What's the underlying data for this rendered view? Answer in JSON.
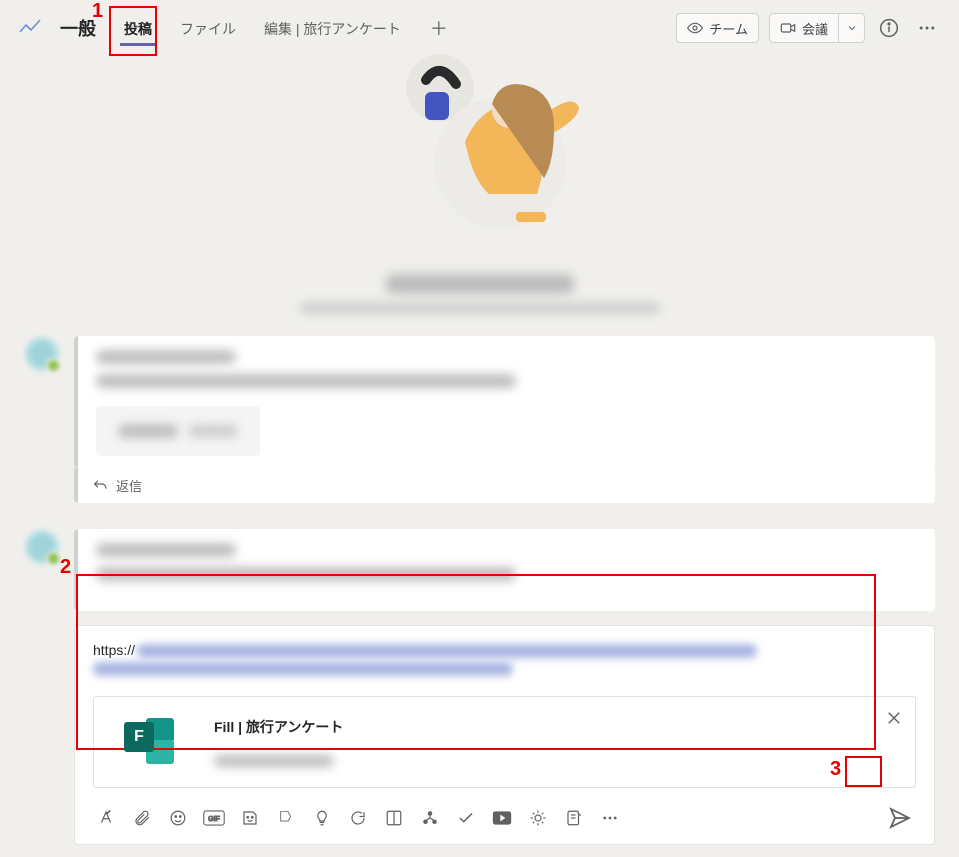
{
  "header": {
    "channel_name": "一般",
    "tabs": [
      {
        "label": "投稿",
        "active": true
      },
      {
        "label": "ファイル",
        "active": false
      },
      {
        "label": "編集 | 旅行アンケート",
        "active": false
      }
    ],
    "team_button": "チーム",
    "meet_button": "会議"
  },
  "reply_label": "返信",
  "compose": {
    "url_prefix": "https://",
    "link_card": {
      "title": "Fill | 旅行アンケート",
      "icon_letter": "F"
    }
  },
  "annotations": {
    "a1": "1",
    "a2": "2",
    "a3": "3"
  },
  "toolbar_icons": [
    "format-icon",
    "attach-icon",
    "emoji-icon",
    "gif-icon",
    "sticker-icon",
    "share-icon",
    "bulb-icon",
    "loop-icon",
    "board-icon",
    "org-icon",
    "approve-icon",
    "video-icon",
    "weather-icon",
    "forms-icon",
    "more-icon"
  ]
}
